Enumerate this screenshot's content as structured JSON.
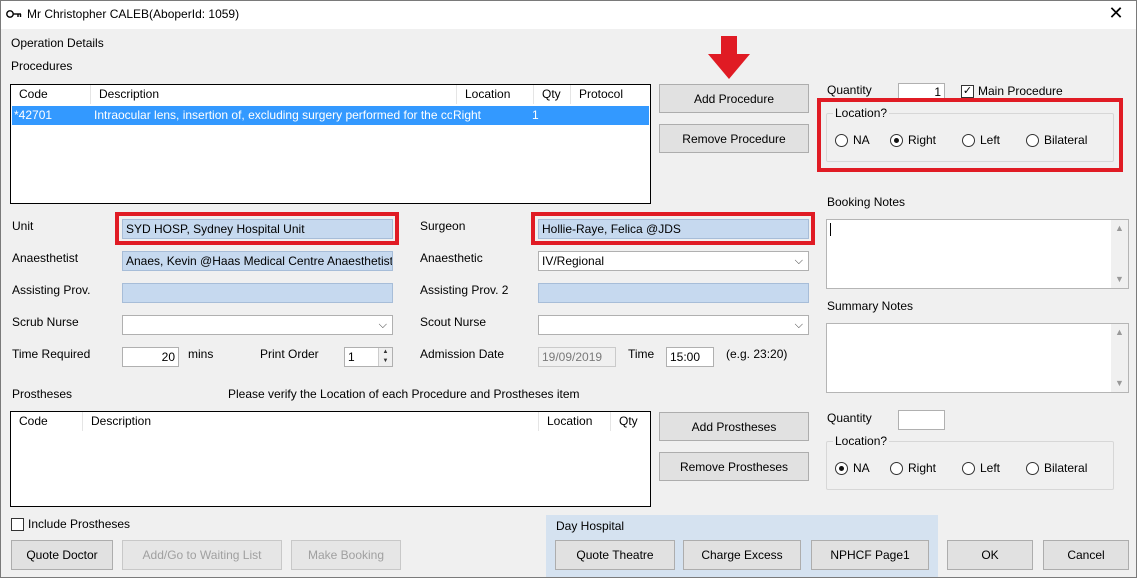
{
  "window": {
    "title": "Mr Christopher CALEB(AboperId: 1059)",
    "icon": "key-icon",
    "close": "✕"
  },
  "section": {
    "operation_details": "Operation Details",
    "procedures": "Procedures"
  },
  "procedures_table": {
    "headers": {
      "code": "Code",
      "description": "Description",
      "location": "Location",
      "qty": "Qty",
      "protocol": "Protocol"
    },
    "rows": [
      {
        "code": "*42701",
        "description": "Intraocular lens, insertion of, excluding surgery performed for the correcti...",
        "location": "Right",
        "qty": "1",
        "protocol": ""
      }
    ]
  },
  "procedure_buttons": {
    "add": "Add Procedure",
    "remove": "Remove Procedure"
  },
  "procedure_opts": {
    "quantity_label": "Quantity",
    "quantity_value": "1",
    "main_procedure_label": "Main Procedure",
    "main_procedure_checked": true,
    "location_legend": "Location?",
    "location_options": [
      "NA",
      "Right",
      "Left",
      "Bilateral"
    ],
    "location_selected": "Right"
  },
  "form": {
    "unit_label": "Unit",
    "unit_value": "SYD HOSP, Sydney Hospital Unit",
    "surgeon_label": "Surgeon",
    "surgeon_value": "Hollie-Raye, Felica @JDS",
    "anaesthetist_label": "Anaesthetist",
    "anaesthetist_value": "Anaes, Kevin @Haas Medical Centre Anaesthetist Haas",
    "anaesthetic_label": "Anaesthetic",
    "anaesthetic_value": "IV/Regional",
    "assisting_label": "Assisting Prov.",
    "assisting_value": "",
    "assisting2_label": "Assisting Prov. 2",
    "assisting2_value": "",
    "scrub_label": "Scrub Nurse",
    "scrub_value": "",
    "scout_label": "Scout Nurse",
    "scout_value": "",
    "time_required_label": "Time Required",
    "time_required_value": "20",
    "mins_label": "mins",
    "print_order_label": "Print Order",
    "print_order_value": "1",
    "admission_label": "Admission Date",
    "admission_value": "19/09/2019",
    "time_label": "Time",
    "time_value": "15:00",
    "time_hint": "(e.g. 23:20)"
  },
  "notes": {
    "booking_label": "Booking Notes",
    "booking_value": "",
    "summary_label": "Summary Notes",
    "summary_value": ""
  },
  "prostheses": {
    "label": "Prostheses",
    "verify_note": "Please verify the Location of each Procedure and Prostheses item",
    "headers": {
      "code": "Code",
      "description": "Description",
      "location": "Location",
      "qty": "Qty"
    },
    "add": "Add Prostheses",
    "remove": "Remove Prostheses",
    "quantity_label": "Quantity",
    "quantity_value": "",
    "location_legend": "Location?",
    "location_options": [
      "NA",
      "Right",
      "Left",
      "Bilateral"
    ],
    "location_selected": "NA",
    "include_label": "Include Prostheses"
  },
  "footer": {
    "quote_doctor": "Quote Doctor",
    "waiting_list": "Add/Go to Waiting List",
    "make_booking": "Make Booking",
    "day_hospital": "Day Hospital",
    "quote_theatre": "Quote Theatre",
    "charge_excess": "Charge Excess",
    "nphcf": "NPHCF Page1",
    "ok": "OK",
    "cancel": "Cancel"
  },
  "colors": {
    "highlight_red": "#e01b24",
    "selection_blue": "#3399ff",
    "field_blue": "#c6d9ef",
    "day_hospital_bg": "#d5e2f0"
  }
}
